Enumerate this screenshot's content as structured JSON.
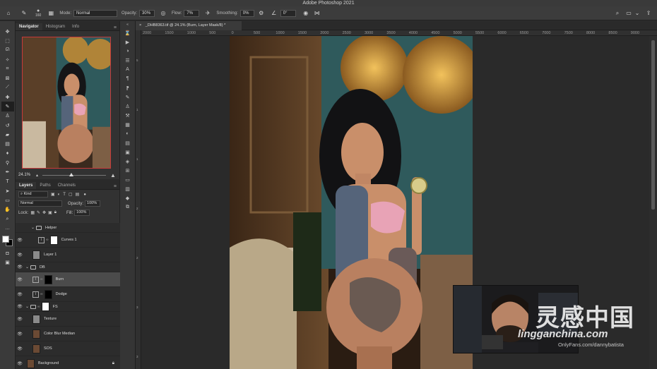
{
  "app": {
    "title": "Adobe Photoshop 2021"
  },
  "options_bar": {
    "brush_size": "160",
    "mode_label": "Mode:",
    "mode_value": "Normal",
    "opacity_label": "Opacity:",
    "opacity_value": "30%",
    "flow_label": "Flow:",
    "flow_value": "7%",
    "smoothing_label": "Smoothing:",
    "smoothing_value": "0%",
    "angle_value": "0°"
  },
  "navigator": {
    "tabs": [
      "Navigator",
      "Histogram",
      "Info"
    ],
    "zoom": "24.1%",
    "zoom_slider_level": 0.45
  },
  "layers_panel": {
    "tabs": [
      "Layers",
      "Paths",
      "Channels"
    ],
    "kind_label": "Kind",
    "blend_mode": "Normal",
    "opacity_label": "Opacity:",
    "opacity_value": "100%",
    "lock_label": "Lock:",
    "fill_label": "Fill:",
    "fill_value": "100%",
    "layers": [
      {
        "name": "Helper",
        "type": "group",
        "visible": false,
        "indent": 1
      },
      {
        "name": "Curves 1",
        "type": "adjustment",
        "visible": true,
        "indent": 2,
        "mask": "white"
      },
      {
        "name": "Layer 1",
        "type": "pixel",
        "visible": true,
        "indent": 1
      },
      {
        "name": "DB",
        "type": "group",
        "visible": true,
        "indent": 0
      },
      {
        "name": "Burn",
        "type": "adjustment",
        "visible": true,
        "indent": 1,
        "mask": "black",
        "selected": true
      },
      {
        "name": "Dodge",
        "type": "adjustment",
        "visible": true,
        "indent": 1,
        "mask": "black"
      },
      {
        "name": "FS",
        "type": "group-mask",
        "visible": true,
        "indent": 0,
        "mask": "white"
      },
      {
        "name": "Texture",
        "type": "pixel",
        "visible": true,
        "indent": 1
      },
      {
        "name": "Color Blur Median",
        "type": "photo",
        "visible": true,
        "indent": 1
      },
      {
        "name": "SOS",
        "type": "photo",
        "visible": true,
        "indent": 1
      },
      {
        "name": "Background",
        "type": "photo",
        "visible": true,
        "indent": 0
      }
    ]
  },
  "document": {
    "tab_title": "_DHB8363.tif @ 24.1% (Burn, Layer Mask/8) *",
    "ruler_ticks": [
      "2000",
      "1500",
      "1000",
      "500",
      "0",
      "500",
      "1000",
      "1500",
      "2000",
      "2500",
      "3000",
      "3500",
      "4000",
      "4500",
      "5000",
      "5500",
      "6000",
      "6500",
      "7000",
      "7500",
      "8000",
      "8500",
      "9000"
    ]
  },
  "watermark": {
    "chinese": "灵感中国",
    "english": "lingganchina.com",
    "credit": "OnlyFans.com/dannybatista"
  },
  "colors": {
    "accent_selected_layer": "#4b4b4b",
    "navigator_frame": "#c73a3a",
    "teal_wall": "#2f5a5c",
    "skin": "#c98f6a",
    "lingerie": "#e8a3b6"
  }
}
